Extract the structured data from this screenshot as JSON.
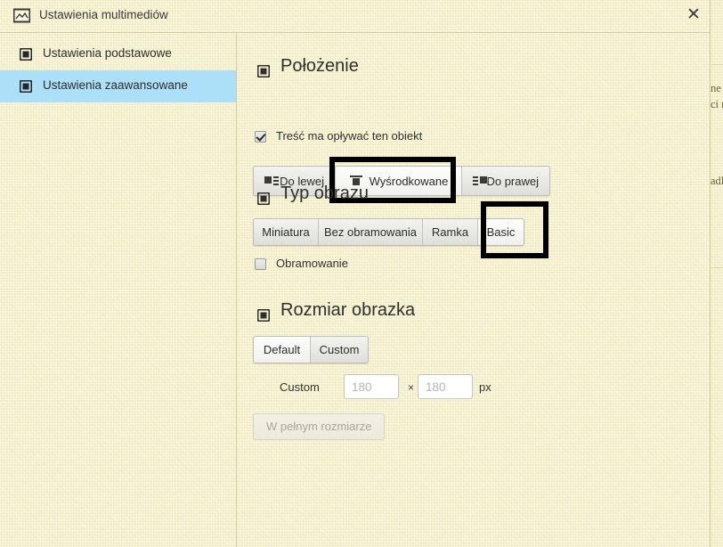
{
  "window": {
    "title": "Ustawienia multimediów",
    "title_icon": "image-icon",
    "close_label": "✕"
  },
  "sidebar": {
    "items": [
      {
        "label": "Ustawienia podstawowe",
        "icon": "square-icon",
        "selected": false
      },
      {
        "label": "Ustawienia zaawansowane",
        "icon": "square-icon",
        "selected": true
      }
    ],
    "selected_bg": "#ace0f9"
  },
  "sections": {
    "position": {
      "heading": "Położenie",
      "heading_icon": "square-icon",
      "float_checkbox": {
        "label": "Treść ma opływać ten obiekt",
        "checked": true
      },
      "align_buttons": [
        {
          "label": "Do lewej",
          "icon": "align-left-icon",
          "active": false
        },
        {
          "label": "Wyśrodkowane",
          "icon": "align-center-icon",
          "active": true
        },
        {
          "label": "Do prawej",
          "icon": "align-right-icon",
          "active": false
        }
      ]
    },
    "image_type": {
      "heading": "Typ obrazu",
      "heading_icon": "square-icon",
      "type_buttons": [
        {
          "label": "Miniatura",
          "active": false
        },
        {
          "label": "Bez obramowania",
          "active": false
        },
        {
          "label": "Ramka",
          "active": false
        },
        {
          "label": "Basic",
          "active": true
        }
      ],
      "border_checkbox": {
        "label": "Obramowanie",
        "checked": false
      }
    },
    "image_size": {
      "heading": "Rozmiar obrazka",
      "heading_icon": "square-icon",
      "size_buttons": [
        {
          "label": "Default",
          "active": true
        },
        {
          "label": "Custom",
          "active": false
        }
      ],
      "custom_label": "Custom",
      "width_value": "",
      "width_placeholder": "180",
      "separator": "×",
      "height_value": "",
      "height_placeholder": "180",
      "unit": "px",
      "full_size_button": "W pełnym rozmiarze"
    }
  },
  "highlights": [
    {
      "name": "highlight-wysrodkowane",
      "color": "#000000"
    },
    {
      "name": "highlight-basic",
      "color": "#000000"
    }
  ],
  "background_page": {
    "fragments": [
      "ne",
      "ci n",
      "adl"
    ]
  }
}
